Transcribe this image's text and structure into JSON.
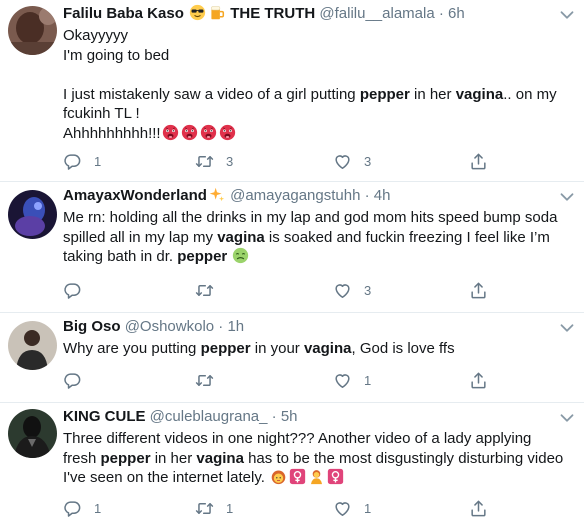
{
  "tweets": [
    {
      "name": "Falilu Baba Kaso",
      "name_suffix": "THE TRUTH",
      "name_emojis": [
        "sunglasses-face",
        "beer-mug"
      ],
      "handle": "@falilu__alamala",
      "sep": "·",
      "time": "6h",
      "lines": {
        "l1": "Okayyyyy",
        "l2": "I'm going to bed",
        "l3a": "I just mistakenly saw a video of a girl putting ",
        "l3b": "pepper",
        "l3c": " in her ",
        "l3d": "vagina",
        "l3e": ".. on my",
        "l4": "fcukinh TL !",
        "l5": "Ahhhhhhhhh!!!"
      },
      "text_emojis": [
        "hot-face",
        "hot-face",
        "hot-face",
        "hot-face"
      ],
      "replies": "1",
      "retweets": "3",
      "likes": "3"
    },
    {
      "name": "AmayaxWonderland",
      "name_emojis": [
        "sparkles"
      ],
      "handle": "@amayagangstuhh",
      "sep": "·",
      "time": "4h",
      "lines": {
        "l1": "Me rn: holding all the drinks in my lap and god mom hits speed bump soda",
        "l2a": "spilled all in my lap my ",
        "l2b": "vagina",
        "l2c": " is soaked and fuckin freezing I feel like I’m",
        "l3a": "taking bath in dr. ",
        "l3b": "pepper"
      },
      "text_emojis": [
        "nauseated-face"
      ],
      "replies": "",
      "retweets": "",
      "likes": "3"
    },
    {
      "name": "Big Oso",
      "handle": "@Oshowkolo",
      "sep": "·",
      "time": "1h",
      "lines": {
        "l1a": "Why are you putting ",
        "l1b": "pepper",
        "l1c": " in your ",
        "l1d": "vagina",
        "l1e": ", God is love ffs"
      },
      "replies": "",
      "retweets": "",
      "likes": "1"
    },
    {
      "name": "KING CULE",
      "handle": "@culeblaugrana_",
      "sep": "·",
      "time": "5h",
      "lines": {
        "l1": "Three different videos in one night???  Another video of a lady applying",
        "l2a": "fresh ",
        "l2b": "pepper",
        "l2c": " in her ",
        "l2d": "vagina",
        "l2e": " has to be the most disgustingly disturbing video",
        "l3": "I've seen on the internet lately."
      },
      "text_emojis": [
        "woman-face",
        "female-sign",
        "woman-bowing",
        "female-sign"
      ],
      "replies": "1",
      "retweets": "1",
      "likes": "1"
    }
  ],
  "icons": {
    "reply": "speech-bubble-icon",
    "retweet": "retweet-arrows-icon",
    "like": "heart-icon",
    "share": "share-upload-icon",
    "more": "chevron-down-icon"
  },
  "colors": {
    "text": "#14171a",
    "secondary": "#657786",
    "divider": "#e6ecf0"
  }
}
